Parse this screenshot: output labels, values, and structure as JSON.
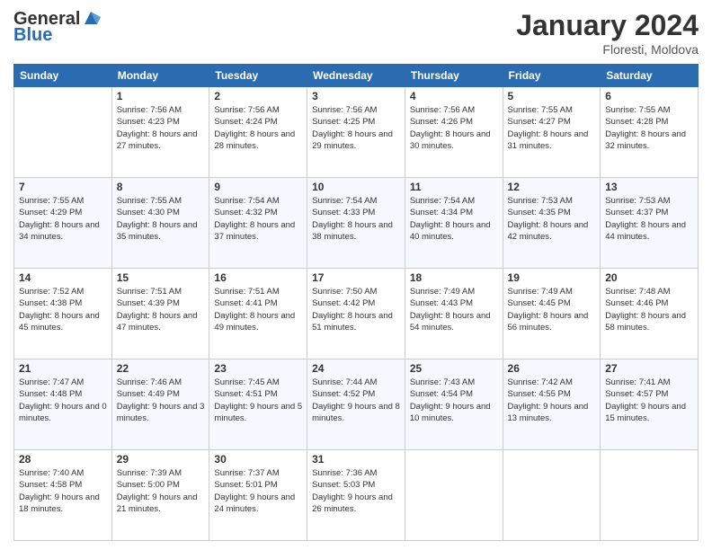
{
  "logo": {
    "general": "General",
    "blue": "Blue"
  },
  "title": "January 2024",
  "location": "Floresti, Moldova",
  "days_header": [
    "Sunday",
    "Monday",
    "Tuesday",
    "Wednesday",
    "Thursday",
    "Friday",
    "Saturday"
  ],
  "weeks": [
    [
      {
        "day": "",
        "sunrise": "",
        "sunset": "",
        "daylight": ""
      },
      {
        "day": "1",
        "sunrise": "Sunrise: 7:56 AM",
        "sunset": "Sunset: 4:23 PM",
        "daylight": "Daylight: 8 hours and 27 minutes."
      },
      {
        "day": "2",
        "sunrise": "Sunrise: 7:56 AM",
        "sunset": "Sunset: 4:24 PM",
        "daylight": "Daylight: 8 hours and 28 minutes."
      },
      {
        "day": "3",
        "sunrise": "Sunrise: 7:56 AM",
        "sunset": "Sunset: 4:25 PM",
        "daylight": "Daylight: 8 hours and 29 minutes."
      },
      {
        "day": "4",
        "sunrise": "Sunrise: 7:56 AM",
        "sunset": "Sunset: 4:26 PM",
        "daylight": "Daylight: 8 hours and 30 minutes."
      },
      {
        "day": "5",
        "sunrise": "Sunrise: 7:55 AM",
        "sunset": "Sunset: 4:27 PM",
        "daylight": "Daylight: 8 hours and 31 minutes."
      },
      {
        "day": "6",
        "sunrise": "Sunrise: 7:55 AM",
        "sunset": "Sunset: 4:28 PM",
        "daylight": "Daylight: 8 hours and 32 minutes."
      }
    ],
    [
      {
        "day": "7",
        "sunrise": "Sunrise: 7:55 AM",
        "sunset": "Sunset: 4:29 PM",
        "daylight": "Daylight: 8 hours and 34 minutes."
      },
      {
        "day": "8",
        "sunrise": "Sunrise: 7:55 AM",
        "sunset": "Sunset: 4:30 PM",
        "daylight": "Daylight: 8 hours and 35 minutes."
      },
      {
        "day": "9",
        "sunrise": "Sunrise: 7:54 AM",
        "sunset": "Sunset: 4:32 PM",
        "daylight": "Daylight: 8 hours and 37 minutes."
      },
      {
        "day": "10",
        "sunrise": "Sunrise: 7:54 AM",
        "sunset": "Sunset: 4:33 PM",
        "daylight": "Daylight: 8 hours and 38 minutes."
      },
      {
        "day": "11",
        "sunrise": "Sunrise: 7:54 AM",
        "sunset": "Sunset: 4:34 PM",
        "daylight": "Daylight: 8 hours and 40 minutes."
      },
      {
        "day": "12",
        "sunrise": "Sunrise: 7:53 AM",
        "sunset": "Sunset: 4:35 PM",
        "daylight": "Daylight: 8 hours and 42 minutes."
      },
      {
        "day": "13",
        "sunrise": "Sunrise: 7:53 AM",
        "sunset": "Sunset: 4:37 PM",
        "daylight": "Daylight: 8 hours and 44 minutes."
      }
    ],
    [
      {
        "day": "14",
        "sunrise": "Sunrise: 7:52 AM",
        "sunset": "Sunset: 4:38 PM",
        "daylight": "Daylight: 8 hours and 45 minutes."
      },
      {
        "day": "15",
        "sunrise": "Sunrise: 7:51 AM",
        "sunset": "Sunset: 4:39 PM",
        "daylight": "Daylight: 8 hours and 47 minutes."
      },
      {
        "day": "16",
        "sunrise": "Sunrise: 7:51 AM",
        "sunset": "Sunset: 4:41 PM",
        "daylight": "Daylight: 8 hours and 49 minutes."
      },
      {
        "day": "17",
        "sunrise": "Sunrise: 7:50 AM",
        "sunset": "Sunset: 4:42 PM",
        "daylight": "Daylight: 8 hours and 51 minutes."
      },
      {
        "day": "18",
        "sunrise": "Sunrise: 7:49 AM",
        "sunset": "Sunset: 4:43 PM",
        "daylight": "Daylight: 8 hours and 54 minutes."
      },
      {
        "day": "19",
        "sunrise": "Sunrise: 7:49 AM",
        "sunset": "Sunset: 4:45 PM",
        "daylight": "Daylight: 8 hours and 56 minutes."
      },
      {
        "day": "20",
        "sunrise": "Sunrise: 7:48 AM",
        "sunset": "Sunset: 4:46 PM",
        "daylight": "Daylight: 8 hours and 58 minutes."
      }
    ],
    [
      {
        "day": "21",
        "sunrise": "Sunrise: 7:47 AM",
        "sunset": "Sunset: 4:48 PM",
        "daylight": "Daylight: 9 hours and 0 minutes."
      },
      {
        "day": "22",
        "sunrise": "Sunrise: 7:46 AM",
        "sunset": "Sunset: 4:49 PM",
        "daylight": "Daylight: 9 hours and 3 minutes."
      },
      {
        "day": "23",
        "sunrise": "Sunrise: 7:45 AM",
        "sunset": "Sunset: 4:51 PM",
        "daylight": "Daylight: 9 hours and 5 minutes."
      },
      {
        "day": "24",
        "sunrise": "Sunrise: 7:44 AM",
        "sunset": "Sunset: 4:52 PM",
        "daylight": "Daylight: 9 hours and 8 minutes."
      },
      {
        "day": "25",
        "sunrise": "Sunrise: 7:43 AM",
        "sunset": "Sunset: 4:54 PM",
        "daylight": "Daylight: 9 hours and 10 minutes."
      },
      {
        "day": "26",
        "sunrise": "Sunrise: 7:42 AM",
        "sunset": "Sunset: 4:55 PM",
        "daylight": "Daylight: 9 hours and 13 minutes."
      },
      {
        "day": "27",
        "sunrise": "Sunrise: 7:41 AM",
        "sunset": "Sunset: 4:57 PM",
        "daylight": "Daylight: 9 hours and 15 minutes."
      }
    ],
    [
      {
        "day": "28",
        "sunrise": "Sunrise: 7:40 AM",
        "sunset": "Sunset: 4:58 PM",
        "daylight": "Daylight: 9 hours and 18 minutes."
      },
      {
        "day": "29",
        "sunrise": "Sunrise: 7:39 AM",
        "sunset": "Sunset: 5:00 PM",
        "daylight": "Daylight: 9 hours and 21 minutes."
      },
      {
        "day": "30",
        "sunrise": "Sunrise: 7:37 AM",
        "sunset": "Sunset: 5:01 PM",
        "daylight": "Daylight: 9 hours and 24 minutes."
      },
      {
        "day": "31",
        "sunrise": "Sunrise: 7:36 AM",
        "sunset": "Sunset: 5:03 PM",
        "daylight": "Daylight: 9 hours and 26 minutes."
      },
      {
        "day": "",
        "sunrise": "",
        "sunset": "",
        "daylight": ""
      },
      {
        "day": "",
        "sunrise": "",
        "sunset": "",
        "daylight": ""
      },
      {
        "day": "",
        "sunrise": "",
        "sunset": "",
        "daylight": ""
      }
    ]
  ]
}
